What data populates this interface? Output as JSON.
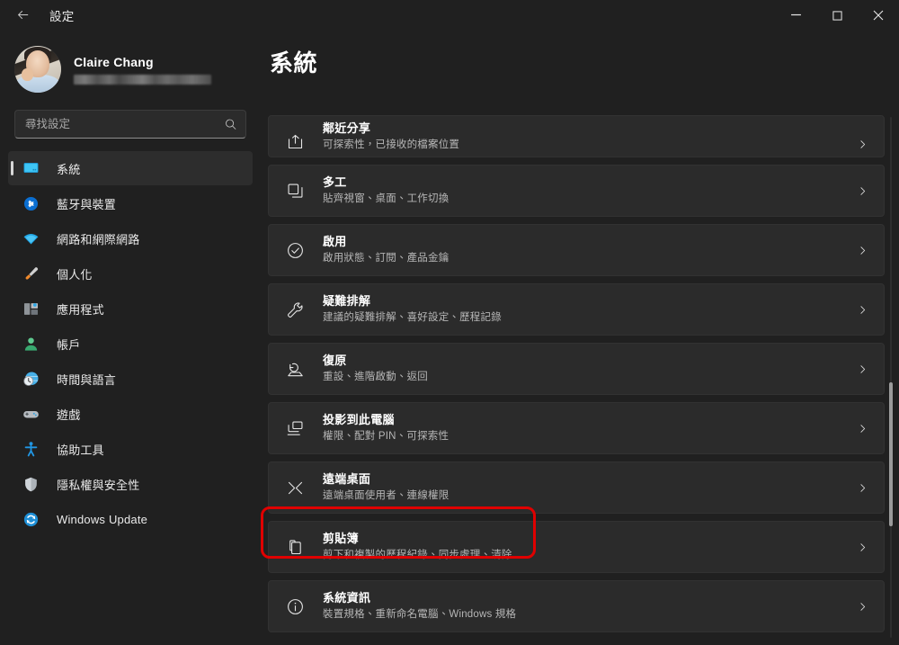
{
  "window": {
    "title": "設定",
    "back_label": "back-arrow",
    "minimize_label": "最小化",
    "maximize_label": "最大化",
    "close_label": "關閉"
  },
  "accounts": {
    "name": "Claire Chang",
    "email_masked": ""
  },
  "search": {
    "placeholder": "尋找設定",
    "value": ""
  },
  "sidebar": {
    "items": [
      {
        "label": "系統",
        "icon": "monitor-icon",
        "selected": true
      },
      {
        "label": "藍牙與裝置",
        "icon": "bluetooth-icon",
        "selected": false
      },
      {
        "label": "網路和網際網路",
        "icon": "wifi-icon",
        "selected": false
      },
      {
        "label": "個人化",
        "icon": "paintbrush-icon",
        "selected": false
      },
      {
        "label": "應用程式",
        "icon": "apps-icon",
        "selected": false
      },
      {
        "label": "帳戶",
        "icon": "person-icon",
        "selected": false
      },
      {
        "label": "時間與語言",
        "icon": "clock-globe-icon",
        "selected": false
      },
      {
        "label": "遊戲",
        "icon": "gamepad-icon",
        "selected": false
      },
      {
        "label": "協助工具",
        "icon": "accessibility-icon",
        "selected": false
      },
      {
        "label": "隱私權與安全性",
        "icon": "shield-icon",
        "selected": false
      },
      {
        "label": "Windows Update",
        "icon": "update-icon",
        "selected": false
      }
    ]
  },
  "main": {
    "page_title": "系統",
    "rows": [
      {
        "title": "鄰近分享",
        "subtitle": "可探索性，已接收的檔案位置",
        "icon": "share-icon",
        "highlighted": false
      },
      {
        "title": "多工",
        "subtitle": "貼齊視窗、桌面、工作切換",
        "icon": "multitask-icon",
        "highlighted": false
      },
      {
        "title": "啟用",
        "subtitle": "啟用狀態、訂閱、產品金鑰",
        "icon": "check-circle-icon",
        "highlighted": false
      },
      {
        "title": "疑難排解",
        "subtitle": "建議的疑難排解、喜好設定、歷程記錄",
        "icon": "wrench-icon",
        "highlighted": false
      },
      {
        "title": "復原",
        "subtitle": "重設、進階啟動、返回",
        "icon": "recovery-icon",
        "highlighted": false
      },
      {
        "title": "投影到此電腦",
        "subtitle": "權限、配對 PIN、可探索性",
        "icon": "project-icon",
        "highlighted": false
      },
      {
        "title": "遠端桌面",
        "subtitle": "遠端桌面使用者、連線權限",
        "icon": "remote-desktop-icon",
        "highlighted": false
      },
      {
        "title": "剪貼簿",
        "subtitle": "剪下和複製的歷程紀錄、同步處理、清除",
        "icon": "clipboard-icon",
        "highlighted": false
      },
      {
        "title": "系統資訊",
        "subtitle": "裝置規格、重新命名電腦、Windows 規格",
        "icon": "info-circle-icon",
        "highlighted": true
      }
    ]
  },
  "colors": {
    "window_bg": "#202020",
    "card_bg": "#2b2b2b",
    "accent_selection": "#d7d7d7",
    "annotation_red": "#e00000",
    "text_primary": "#ffffff",
    "text_secondary": "#b6b6b6"
  }
}
